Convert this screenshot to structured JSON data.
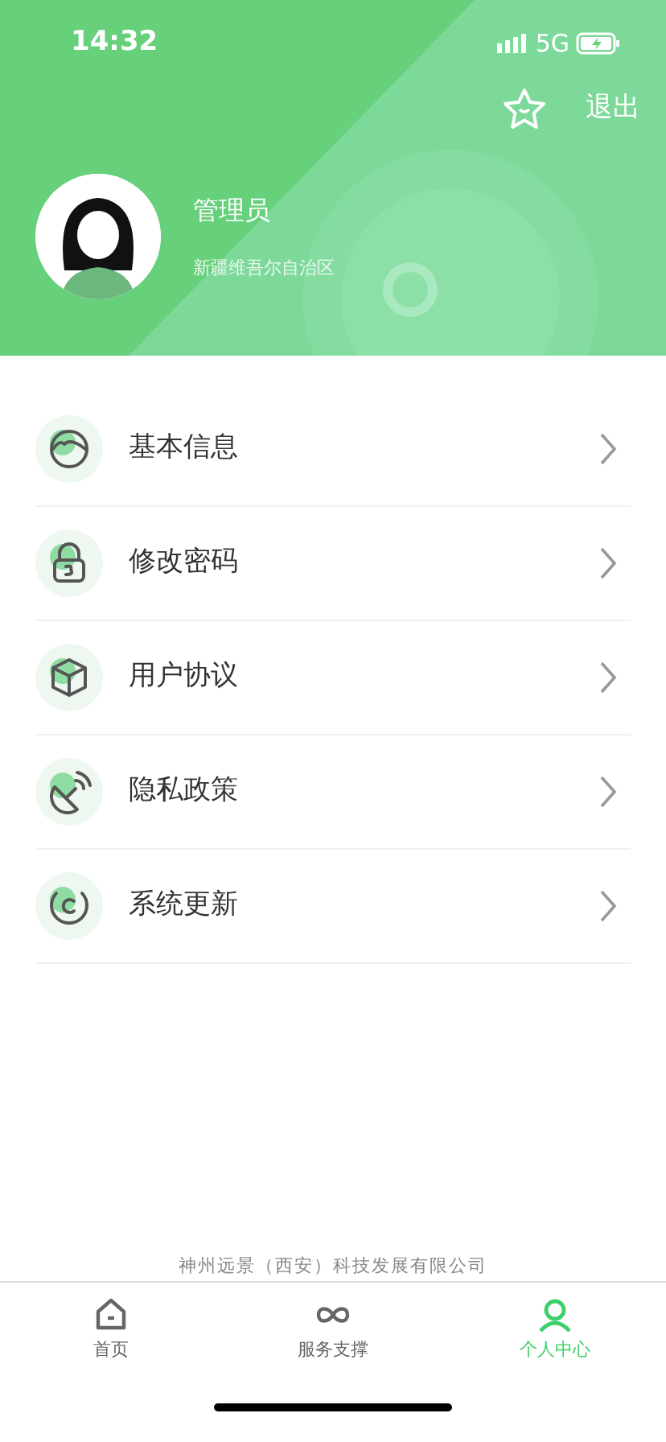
{
  "status_bar": {
    "time": "14:32",
    "network": "5G"
  },
  "header": {
    "logout": "退出",
    "user": {
      "name": "管理员",
      "region": "新疆维吾尔自治区"
    }
  },
  "menu": [
    {
      "label": "基本信息"
    },
    {
      "label": "修改密码"
    },
    {
      "label": "用户协议"
    },
    {
      "label": "隐私政策"
    },
    {
      "label": "系统更新"
    }
  ],
  "footer": "神州远景（西安）科技发展有限公司",
  "tabs": [
    {
      "label": "首页",
      "selected": false
    },
    {
      "label": "服务支撑",
      "selected": false
    },
    {
      "label": "个人中心",
      "selected": true
    }
  ]
}
